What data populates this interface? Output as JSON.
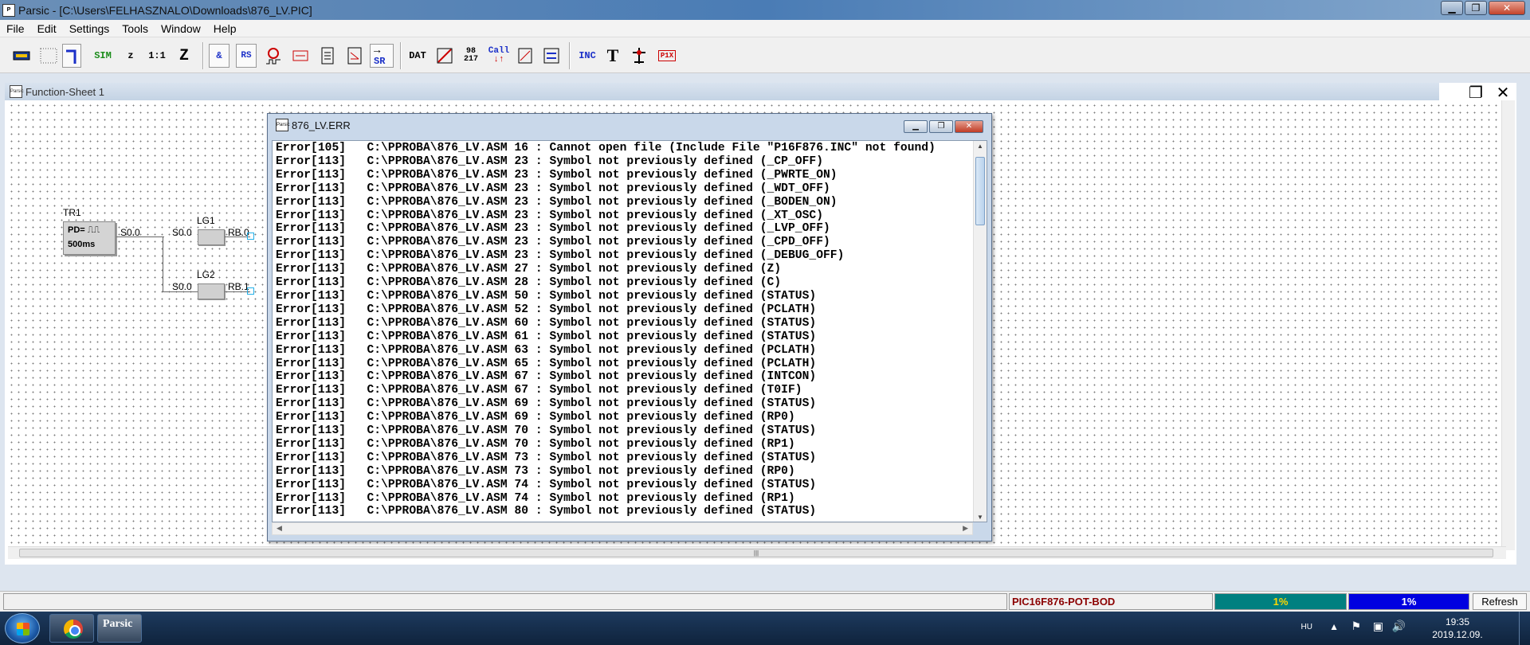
{
  "window": {
    "title": "Parsic - [C:\\Users\\FELHASZNALO\\Downloads\\876_LV.PIC]"
  },
  "menu": [
    "File",
    "Edit",
    "Settings",
    "Tools",
    "Window",
    "Help"
  ],
  "toolbar": {
    "sim": "SIM",
    "z_small": "z",
    "one_to_one": "1:1",
    "z_big": "Z",
    "and": "&",
    "rs": "RS",
    "sr": "SR",
    "dat": "DAT",
    "num_top": "98",
    "num_bottom": "217",
    "call": "Call",
    "inc": "INC",
    "t": "T",
    "p1x": "P1X"
  },
  "sheet": {
    "title": "Function-Sheet 1",
    "icon_label": "Parsic",
    "tr1": {
      "name": "TR1",
      "line1": "PD=",
      "line2": "500ms",
      "out": "S0.0"
    },
    "lg1": {
      "name": "LG1",
      "in": "S0.0",
      "out": "RB.0"
    },
    "lg2": {
      "name": "LG2",
      "in": "S0.0",
      "out": "RB.1"
    }
  },
  "error_window": {
    "title": "876_LV.ERR",
    "icon_label": "Parsic",
    "lines": [
      "Error[105]   C:\\PPROBA\\876_LV.ASM 16 : Cannot open file (Include File \"P16F876.INC\" not found)",
      "Error[113]   C:\\PPROBA\\876_LV.ASM 23 : Symbol not previously defined (_CP_OFF)",
      "Error[113]   C:\\PPROBA\\876_LV.ASM 23 : Symbol not previously defined (_PWRTE_ON)",
      "Error[113]   C:\\PPROBA\\876_LV.ASM 23 : Symbol not previously defined (_WDT_OFF)",
      "Error[113]   C:\\PPROBA\\876_LV.ASM 23 : Symbol not previously defined (_BODEN_ON)",
      "Error[113]   C:\\PPROBA\\876_LV.ASM 23 : Symbol not previously defined (_XT_OSC)",
      "Error[113]   C:\\PPROBA\\876_LV.ASM 23 : Symbol not previously defined (_LVP_OFF)",
      "Error[113]   C:\\PPROBA\\876_LV.ASM 23 : Symbol not previously defined (_CPD_OFF)",
      "Error[113]   C:\\PPROBA\\876_LV.ASM 23 : Symbol not previously defined (_DEBUG_OFF)",
      "Error[113]   C:\\PPROBA\\876_LV.ASM 27 : Symbol not previously defined (Z)",
      "Error[113]   C:\\PPROBA\\876_LV.ASM 28 : Symbol not previously defined (C)",
      "Error[113]   C:\\PPROBA\\876_LV.ASM 50 : Symbol not previously defined (STATUS)",
      "Error[113]   C:\\PPROBA\\876_LV.ASM 52 : Symbol not previously defined (PCLATH)",
      "Error[113]   C:\\PPROBA\\876_LV.ASM 60 : Symbol not previously defined (STATUS)",
      "Error[113]   C:\\PPROBA\\876_LV.ASM 61 : Symbol not previously defined (STATUS)",
      "Error[113]   C:\\PPROBA\\876_LV.ASM 63 : Symbol not previously defined (PCLATH)",
      "Error[113]   C:\\PPROBA\\876_LV.ASM 65 : Symbol not previously defined (PCLATH)",
      "Error[113]   C:\\PPROBA\\876_LV.ASM 67 : Symbol not previously defined (INTCON)",
      "Error[113]   C:\\PPROBA\\876_LV.ASM 67 : Symbol not previously defined (T0IF)",
      "Error[113]   C:\\PPROBA\\876_LV.ASM 69 : Symbol not previously defined (STATUS)",
      "Error[113]   C:\\PPROBA\\876_LV.ASM 69 : Symbol not previously defined (RP0)",
      "Error[113]   C:\\PPROBA\\876_LV.ASM 70 : Symbol not previously defined (STATUS)",
      "Error[113]   C:\\PPROBA\\876_LV.ASM 70 : Symbol not previously defined (RP1)",
      "Error[113]   C:\\PPROBA\\876_LV.ASM 73 : Symbol not previously defined (STATUS)",
      "Error[113]   C:\\PPROBA\\876_LV.ASM 73 : Symbol not previously defined (RP0)",
      "Error[113]   C:\\PPROBA\\876_LV.ASM 74 : Symbol not previously defined (STATUS)",
      "Error[113]   C:\\PPROBA\\876_LV.ASM 74 : Symbol not previously defined (RP1)",
      "Error[113]   C:\\PPROBA\\876_LV.ASM 80 : Symbol not previously defined (STATUS)"
    ]
  },
  "statusbar": {
    "device": "PIC16F876-POT-BOD",
    "meter1": "1%",
    "meter1_color": "#008080",
    "meter2": "1%",
    "meter2_color": "#0000e0",
    "refresh": "Refresh"
  },
  "taskbar": {
    "parsic_label": "Parsic",
    "lang": "HU",
    "time": "19:35",
    "date": "2019.12.09."
  },
  "colors": {
    "device_text": "#8b0000",
    "pin": "#23b0e8"
  }
}
